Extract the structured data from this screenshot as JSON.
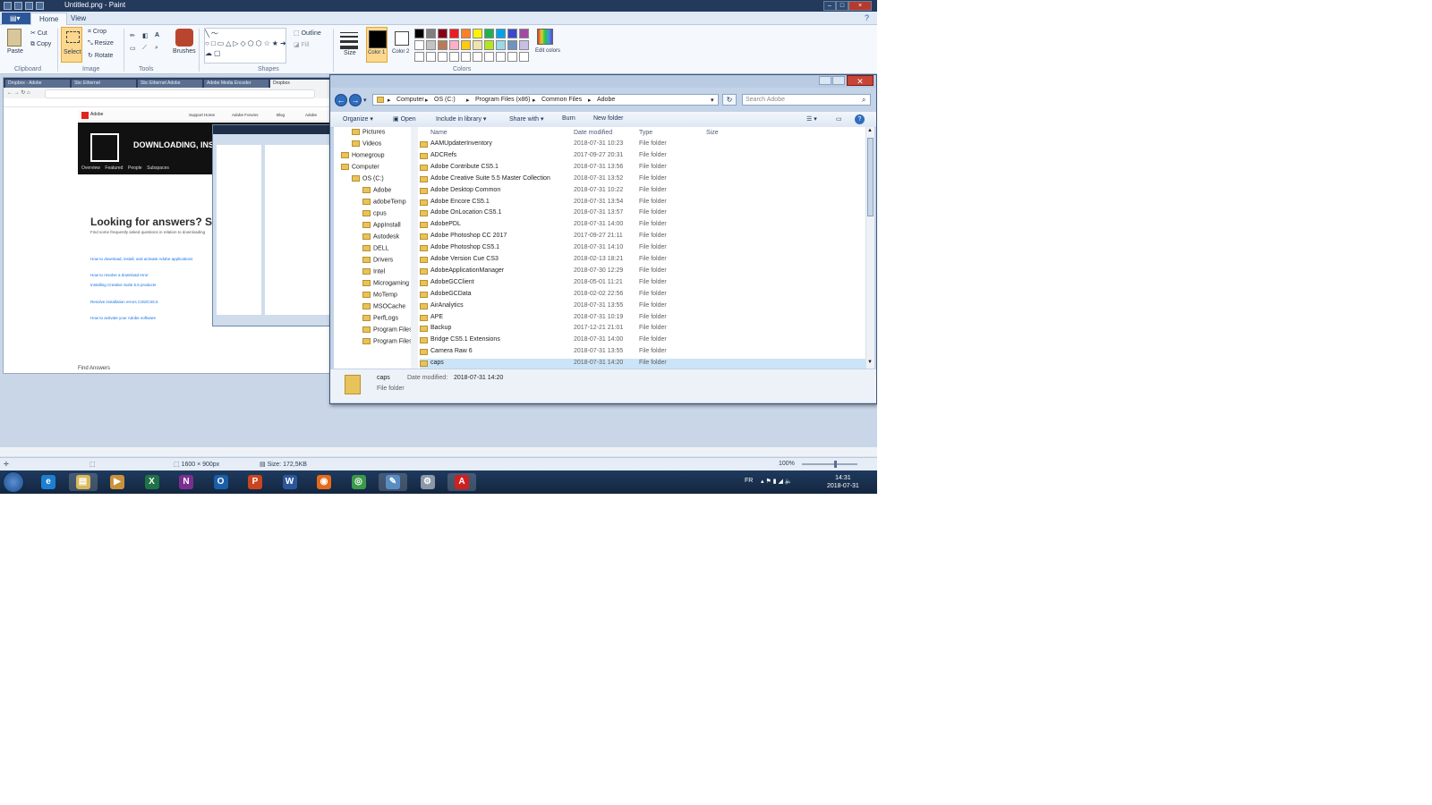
{
  "paint": {
    "title": "Untitled.png - Paint",
    "tabs": {
      "file": "",
      "home": "Home",
      "view": "View"
    },
    "ribbon": {
      "paste": "Paste",
      "cut": "Cut",
      "copy": "Copy",
      "select": "Select",
      "crop": "Crop",
      "resize": "Resize",
      "rotate": "Rotate",
      "brushes": "Brushes",
      "outline": "Outline",
      "fill": "Fill",
      "size": "Size",
      "color1": "Color 1",
      "color2": "Color 2",
      "edit_colors": "Edit colors",
      "groups": {
        "clipboard": "Clipboard",
        "image": "Image",
        "tools": "Tools",
        "shapes": "Shapes",
        "colors": "Colors"
      }
    },
    "palette": [
      "#000000",
      "#7f7f7f",
      "#880015",
      "#ed1c24",
      "#ff7f27",
      "#fff200",
      "#22b14c",
      "#00a2e8",
      "#3f48cc",
      "#a349a4",
      "#ffffff",
      "#c3c3c3",
      "#b97a57",
      "#ffaec9",
      "#ffc90e",
      "#efe4b0",
      "#b5e61d",
      "#99d9ea",
      "#7092be",
      "#c8bfe7"
    ],
    "status": {
      "dimensions": "1600 × 900px",
      "size": "Size: 172,5KB",
      "zoom": "100%"
    }
  },
  "browser_shot": {
    "tabs": [
      "Dropbox - Adobe",
      "Sbc Ethernet",
      "Sbc Ethernet Adobe",
      "Adobe Media Encoder",
      "Dropbox"
    ],
    "hero_text": "DOWNLOADING, INSTA",
    "hero_nav": [
      "Overview",
      "Featured",
      "People",
      "Subspaces"
    ],
    "heading": "Looking for answers? Sta",
    "subheading": "Find some frequently asked questions in relation to downloading",
    "links": [
      "How to download, install, and activate Adobe applications",
      "How to resolve a download error",
      "Installing Creative Suite 5.5 products",
      "Resolve installation errors CS5/CS5.5",
      "How to activate your Adobe software"
    ],
    "footer": "Find Answers",
    "header_items": [
      "Adobe",
      "Support Home",
      "Adobe Forums",
      "Blog",
      "Adobe"
    ]
  },
  "explorer": {
    "breadcrumb": [
      "Computer",
      "OS (C:)",
      "Program Files (x86)",
      "Common Files",
      "Adobe"
    ],
    "search_placeholder": "Search Adobe",
    "commands": [
      "Organize ▾",
      "Open",
      "Include in library ▾",
      "Share with ▾",
      "Burn",
      "New folder"
    ],
    "columns": [
      "Name",
      "Date modified",
      "Type",
      "Size"
    ],
    "nav_items": [
      {
        "label": "Pictures",
        "indent": 1
      },
      {
        "label": "Videos",
        "indent": 1
      },
      {
        "label": "Homegroup",
        "indent": 0
      },
      {
        "label": "Computer",
        "indent": 0
      },
      {
        "label": "OS (C:)",
        "indent": 1
      },
      {
        "label": "Adobe",
        "indent": 2
      },
      {
        "label": "adobeTemp",
        "indent": 2
      },
      {
        "label": "cpus",
        "indent": 2
      },
      {
        "label": "AppInstall",
        "indent": 2
      },
      {
        "label": "Autodesk",
        "indent": 2
      },
      {
        "label": "DELL",
        "indent": 2
      },
      {
        "label": "Drivers",
        "indent": 2
      },
      {
        "label": "Intel",
        "indent": 2
      },
      {
        "label": "Microgaming",
        "indent": 2
      },
      {
        "label": "MoTemp",
        "indent": 2
      },
      {
        "label": "MSOCache",
        "indent": 2
      },
      {
        "label": "PerfLogs",
        "indent": 2
      },
      {
        "label": "Program Files",
        "indent": 2
      },
      {
        "label": "Program Files (",
        "indent": 2
      }
    ],
    "files": [
      {
        "name": "AAMUpdaterInventory",
        "date": "2018-07-31 10:23",
        "type": "File folder"
      },
      {
        "name": "ADCRefs",
        "date": "2017-09-27 20:31",
        "type": "File folder"
      },
      {
        "name": "Adobe Contribute CS5.1",
        "date": "2018-07-31 13:56",
        "type": "File folder"
      },
      {
        "name": "Adobe Creative Suite 5.5 Master Collection",
        "date": "2018-07-31 13:52",
        "type": "File folder"
      },
      {
        "name": "Adobe Desktop Common",
        "date": "2018-07-31 10:22",
        "type": "File folder"
      },
      {
        "name": "Adobe Encore CS5.1",
        "date": "2018-07-31 13:54",
        "type": "File folder"
      },
      {
        "name": "Adobe OnLocation CS5.1",
        "date": "2018-07-31 13:57",
        "type": "File folder"
      },
      {
        "name": "AdobePDL",
        "date": "2018-07-31 14:00",
        "type": "File folder"
      },
      {
        "name": "Adobe Photoshop CC 2017",
        "date": "2017-09-27 21:11",
        "type": "File folder"
      },
      {
        "name": "Adobe Photoshop CS5.1",
        "date": "2018-07-31 14:10",
        "type": "File folder"
      },
      {
        "name": "Adobe Version Cue CS3",
        "date": "2018-02-13 18:21",
        "type": "File folder"
      },
      {
        "name": "AdobeApplicationManager",
        "date": "2018-07-30 12:29",
        "type": "File folder"
      },
      {
        "name": "AdobeGCClient",
        "date": "2018-05-01 11:21",
        "type": "File folder"
      },
      {
        "name": "AdobeGCData",
        "date": "2018-02-02 22:56",
        "type": "File folder"
      },
      {
        "name": "AirAnalytics",
        "date": "2018-07-31 13:55",
        "type": "File folder"
      },
      {
        "name": "APE",
        "date": "2018-07-31 10:19",
        "type": "File folder"
      },
      {
        "name": "Backup",
        "date": "2017-12-21 21:01",
        "type": "File folder"
      },
      {
        "name": "Bridge CS5.1 Extensions",
        "date": "2018-07-31 14:00",
        "type": "File folder"
      },
      {
        "name": "Camera Raw 6",
        "date": "2018-07-31 13:55",
        "type": "File folder"
      },
      {
        "name": "caps",
        "date": "2018-07-31 14:20",
        "type": "File folder"
      }
    ],
    "details": {
      "name": "caps",
      "type": "File folder",
      "date_label": "Date modified:",
      "date": "2018-07-31 14:20"
    }
  },
  "taskbar": {
    "apps": [
      {
        "name": "Internet Explorer",
        "glyph": "e",
        "color": "#1d7fd1"
      },
      {
        "name": "Windows Explorer",
        "glyph": "▤",
        "color": "#d9b85a"
      },
      {
        "name": "Media Player",
        "glyph": "▶",
        "color": "#c9923a"
      },
      {
        "name": "Excel",
        "glyph": "X",
        "color": "#1f7246"
      },
      {
        "name": "OneNote",
        "glyph": "N",
        "color": "#7b2e92"
      },
      {
        "name": "Outlook",
        "glyph": "O",
        "color": "#1a5ea8"
      },
      {
        "name": "PowerPoint",
        "glyph": "P",
        "color": "#c9451f"
      },
      {
        "name": "Word",
        "glyph": "W",
        "color": "#2b579a"
      },
      {
        "name": "Firefox",
        "glyph": "◉",
        "color": "#e66a1b"
      },
      {
        "name": "Chrome",
        "glyph": "◎",
        "color": "#3a9a4a"
      },
      {
        "name": "Paint",
        "glyph": "✎",
        "color": "#5a8cc4"
      },
      {
        "name": "Tool",
        "glyph": "⚙",
        "color": "#8a98a8"
      },
      {
        "name": "Adobe",
        "glyph": "A",
        "color": "#d01f1f"
      }
    ],
    "lang": "FR",
    "time": "14:31",
    "date": "2018-07-31"
  }
}
